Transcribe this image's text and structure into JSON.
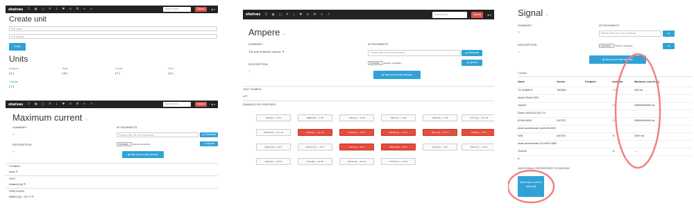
{
  "nav": {
    "brand": "shelves",
    "icons": [
      "☰",
      "▣",
      "□",
      "#",
      "↓",
      "♥",
      "≡",
      "⌘",
      "+",
      "↗"
    ],
    "search_placeholder": "Search items",
    "search_button": "Search",
    "user": "♣ ▾"
  },
  "create": {
    "title": "Create unit",
    "name_placeholder": "Unit name",
    "symbol_placeholder": "Unit symbol",
    "button": "Create",
    "units_heading": "Units",
    "units": [
      {
        "name": "Ampere",
        "symbol": "[ A ]"
      },
      {
        "name": "Byte",
        "symbol": "[ B ]"
      },
      {
        "name": "Farad",
        "symbol": "[ F ]"
      },
      {
        "name": "Ohm",
        "symbol": "[ Ω ]"
      },
      {
        "name": "Voltage",
        "symbol": "[ V ]"
      }
    ]
  },
  "maxcurrent": {
    "title": "Maximum current",
    "title_edit": "✎",
    "summary_label": "SUMMARY",
    "summary_value": "✎",
    "description_label": "DESCRIPTION",
    "description_value": "✎",
    "attachments_label": "ATTACHMENTS",
    "url_placeholder": "Please enter the url to download",
    "download_button": "☁ Download",
    "browse_button": "Prochazet...",
    "no_file": "Soubory nevybrány",
    "upload_button": "☁ Upload",
    "webcam_button": "◉ Take picture with webcam",
    "symbol_label": "SYMBOL",
    "symbol_value": "Imax ✎",
    "unit_label": "UNIT",
    "unit_value": "Ampere [A] ✎",
    "precision_label": "PRECISION",
    "precision_value": "NANO [n] = 10^-9 ✎"
  },
  "ampere": {
    "title": "Ampere",
    "title_edit": "✎",
    "summary_label": "SUMMARY",
    "summary_value": "The unit of electric current. ✎",
    "description_label": "DESCRIPTION",
    "description_value": "✎",
    "attachments_label": "ATTACHMENTS",
    "url_placeholder": "Please enter the url to download",
    "download_button": "☁ Download",
    "browse_button": "Procházet...",
    "no_file": "Soubory nevybrány",
    "upload_button": "☁ Upload",
    "webcam_button": "◉ Take picture with webcam",
    "unit_symbol_label": "UNIT SYMBOL",
    "unit_symbol_value": "A ✎",
    "prefixes_label": "ENABLED ISO PREFIXES",
    "prefixes": [
      {
        "label": "KIBI [ki] — 2^10",
        "on": false
      },
      {
        "label": "MEBI [Mi] — 2^20",
        "on": false
      },
      {
        "label": "GIBI [Gi] — 2^30",
        "on": false
      },
      {
        "label": "TEBI [Ti] — 2^40",
        "on": false
      },
      {
        "label": "PEBI [Pi] — 2^50",
        "on": false
      },
      {
        "label": "ATTO [a] — 10^-18",
        "on": false
      },
      {
        "label": "FEMTO [f] — 10^-15",
        "on": false
      },
      {
        "label": "PICO [p] — 10^-12",
        "on": true
      },
      {
        "label": "NANO [n] — 10^-9",
        "on": true
      },
      {
        "label": "MICRO [µ] — 10^-6",
        "on": true
      },
      {
        "label": "MILLI [m] — 10^-3",
        "on": true
      },
      {
        "label": "NONE [] — 10^0",
        "on": true
      },
      {
        "label": "DECA [da] — 10^1",
        "on": false
      },
      {
        "label": "HECTO [h] — 10^2",
        "on": false
      },
      {
        "label": "KILO [k] — 10^3",
        "on": true
      },
      {
        "label": "MEGA [M] — 10^6",
        "on": true
      },
      {
        "label": "GIGA [G] — 10^9",
        "on": false
      },
      {
        "label": "TERA [T] — 10^12",
        "on": false
      },
      {
        "label": "PETA [P] — 10^15",
        "on": false
      },
      {
        "label": "EXA [E] — 10^18",
        "on": false
      },
      {
        "label": "ZETTA [Z] — 10^21",
        "on": false
      },
      {
        "label": "YOTTA [Y] — 10^24",
        "on": false
      }
    ]
  },
  "signal": {
    "title": "Signal",
    "title_edit": "✎",
    "summary_label": "SUMMARY",
    "summary_value": "✎",
    "description_label": "DESCRIPTION",
    "description_value": "✎",
    "attachments_label": "ATTACHMENTS",
    "url_placeholder": "Please enter the url to download",
    "download_button": "☁",
    "browse_button": "Procházet...",
    "no_file": "Soubory nevybrány",
    "upload_button": "☁",
    "webcam_button": "◉ Take picture with webcam",
    "types_label": "TYPES",
    "columns": [
      "Name",
      "Vendor",
      "Footprint",
      "Available",
      "Maximum current [A]"
    ],
    "rows": [
      {
        "name": "TS 4148RXG",
        "vendor": "TAIWAN",
        "footprint": "",
        "available": "120",
        "current": "150 mA"
      },
      {
        "name": "diode,150mA 100V",
        "vendor": "",
        "footprint": "",
        "available": "",
        "current": ""
      },
      {
        "name": "1N4007",
        "vendor": "",
        "footprint": "",
        "available": "15",
        "current": "999999999999 nA"
      },
      {
        "name": "Diode 1000V/1A Uf=1.1V",
        "vendor": "",
        "footprint": "",
        "available": "",
        "current": ""
      },
      {
        "name": "BY500-800V",
        "vendor": "DIOTEC",
        "footprint": "",
        "available": "29",
        "current": "999999999999 nA"
      },
      {
        "name": "dioda usmerňovací rychlá 5A 800V",
        "vendor": "",
        "footprint": "",
        "available": "",
        "current": ""
      },
      {
        "name": "S2M",
        "vendor": "DIOTEC",
        "footprint": "",
        "available": "58",
        "current": "2000 mA"
      },
      {
        "name": "dioda usmerňovací 2A 1000V SMB",
        "vendor": "",
        "footprint": "",
        "available": "",
        "current": ""
      },
      {
        "name": "1N4148",
        "vendor": "",
        "footprint": "",
        "available": "98",
        "current": "—"
      },
      {
        "name": "D",
        "vendor": "",
        "footprint": "",
        "available": "",
        "current": ""
      }
    ],
    "additional_label": "ADDITIONAL PROPERTIES TO DISPLAY",
    "property_button": "Maximum current; Imax [A]"
  },
  "colors": {
    "accent": "#31a2d6",
    "danger": "#d9534f",
    "active_prefix": "#e74c3c",
    "annotation": "#f08080",
    "navbar": "#222222"
  }
}
